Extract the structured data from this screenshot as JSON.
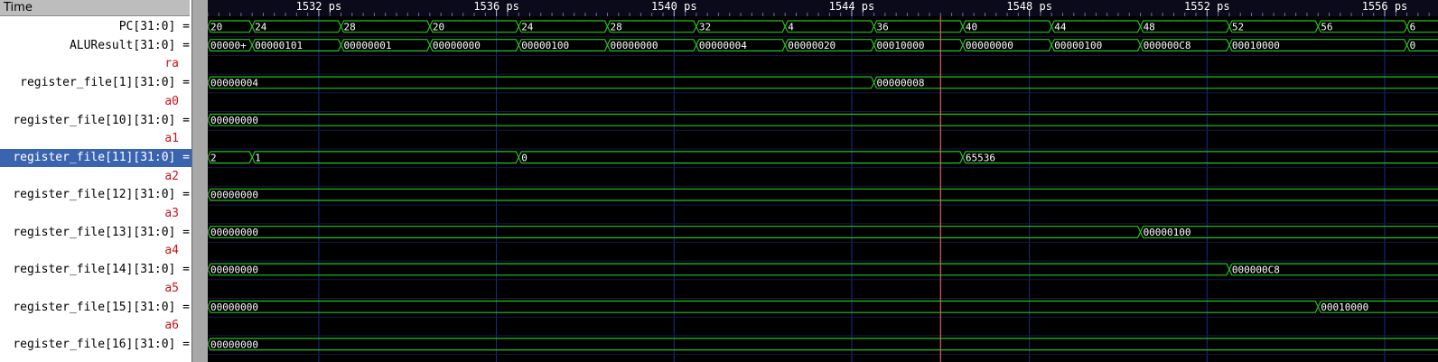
{
  "header": {
    "time_label": "Time",
    "time_unit": "ps"
  },
  "timeline": {
    "start_ps": 1529.5,
    "end_ps": 1557.2,
    "major_ticks": [
      1532,
      1536,
      1540,
      1544,
      1548,
      1552,
      1556
    ],
    "cursor_ps": 1546
  },
  "colors": {
    "signal": "#25c21e",
    "background": "#000000",
    "grid": "#1e2a8c",
    "cursor": "#e06060",
    "alias": "#c8141c",
    "selected": "#3b64b0"
  },
  "rows": [
    {
      "kind": "signal",
      "name": "PC[31:0]",
      "eq": "=",
      "bus": true,
      "segments": [
        {
          "t": 1529.5,
          "v": "20"
        },
        {
          "t": 1530.5,
          "v": "24"
        },
        {
          "t": 1532.5,
          "v": "28"
        },
        {
          "t": 1534.5,
          "v": "20"
        },
        {
          "t": 1536.5,
          "v": "24"
        },
        {
          "t": 1538.5,
          "v": "28"
        },
        {
          "t": 1540.5,
          "v": "32"
        },
        {
          "t": 1542.5,
          "v": "4"
        },
        {
          "t": 1544.5,
          "v": "36"
        },
        {
          "t": 1546.5,
          "v": "40"
        },
        {
          "t": 1548.5,
          "v": "44"
        },
        {
          "t": 1550.5,
          "v": "48"
        },
        {
          "t": 1552.5,
          "v": "52"
        },
        {
          "t": 1554.5,
          "v": "56"
        },
        {
          "t": 1556.5,
          "v": "6"
        }
      ]
    },
    {
      "kind": "signal",
      "name": "ALUResult[31:0]",
      "eq": "=",
      "bus": true,
      "segments": [
        {
          "t": 1529.5,
          "v": "00000+"
        },
        {
          "t": 1530.5,
          "v": "00000101"
        },
        {
          "t": 1532.5,
          "v": "00000001"
        },
        {
          "t": 1534.5,
          "v": "00000000"
        },
        {
          "t": 1536.5,
          "v": "00000100"
        },
        {
          "t": 1538.5,
          "v": "00000000"
        },
        {
          "t": 1540.5,
          "v": "00000004"
        },
        {
          "t": 1542.5,
          "v": "00000020"
        },
        {
          "t": 1544.5,
          "v": "00010000"
        },
        {
          "t": 1546.5,
          "v": "00000000"
        },
        {
          "t": 1548.5,
          "v": "00000100"
        },
        {
          "t": 1550.5,
          "v": "000000C8"
        },
        {
          "t": 1552.5,
          "v": "00010000"
        },
        {
          "t": 1556.5,
          "v": "0"
        }
      ]
    },
    {
      "kind": "alias",
      "name": "ra"
    },
    {
      "kind": "signal",
      "name": "register_file[1][31:0]",
      "eq": "=",
      "bus": true,
      "segments": [
        {
          "t": 1529.5,
          "v": "00000004"
        },
        {
          "t": 1544.5,
          "v": "00000008"
        }
      ]
    },
    {
      "kind": "alias",
      "name": "a0"
    },
    {
      "kind": "signal",
      "name": "register_file[10][31:0]",
      "eq": "=",
      "bus": true,
      "segments": [
        {
          "t": 1529.5,
          "v": "00000000"
        }
      ]
    },
    {
      "kind": "alias",
      "name": "a1"
    },
    {
      "kind": "signal",
      "name": "register_file[11][31:0]",
      "eq": "=",
      "bus": true,
      "selected": true,
      "segments": [
        {
          "t": 1529.5,
          "v": "2"
        },
        {
          "t": 1530.5,
          "v": "1"
        },
        {
          "t": 1536.5,
          "v": "0"
        },
        {
          "t": 1546.5,
          "v": "65536"
        }
      ]
    },
    {
      "kind": "alias",
      "name": "a2"
    },
    {
      "kind": "signal",
      "name": "register_file[12][31:0]",
      "eq": "=",
      "bus": true,
      "segments": [
        {
          "t": 1529.5,
          "v": "00000000"
        }
      ]
    },
    {
      "kind": "alias",
      "name": "a3"
    },
    {
      "kind": "signal",
      "name": "register_file[13][31:0]",
      "eq": "=",
      "bus": true,
      "segments": [
        {
          "t": 1529.5,
          "v": "00000000"
        },
        {
          "t": 1550.5,
          "v": "00000100"
        }
      ]
    },
    {
      "kind": "alias",
      "name": "a4"
    },
    {
      "kind": "signal",
      "name": "register_file[14][31:0]",
      "eq": "=",
      "bus": true,
      "segments": [
        {
          "t": 1529.5,
          "v": "00000000"
        },
        {
          "t": 1552.5,
          "v": "000000C8"
        }
      ]
    },
    {
      "kind": "alias",
      "name": "a5"
    },
    {
      "kind": "signal",
      "name": "register_file[15][31:0]",
      "eq": "=",
      "bus": true,
      "segments": [
        {
          "t": 1529.5,
          "v": "00000000"
        },
        {
          "t": 1554.5,
          "v": "00010000"
        }
      ]
    },
    {
      "kind": "alias",
      "name": "a6"
    },
    {
      "kind": "signal",
      "name": "register_file[16][31:0]",
      "eq": "=",
      "bus": true,
      "segments": [
        {
          "t": 1529.5,
          "v": "00000000"
        }
      ]
    }
  ]
}
